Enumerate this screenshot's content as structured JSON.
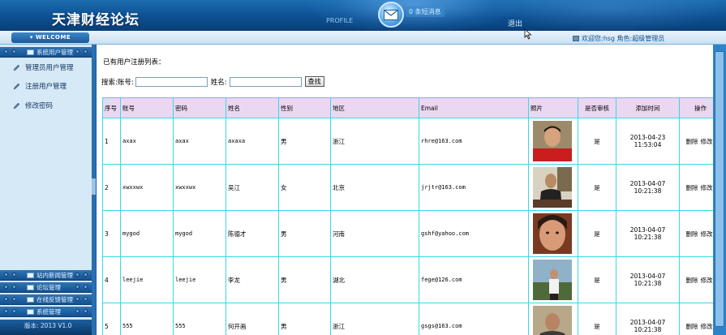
{
  "header": {
    "title": "天津财经论坛",
    "mid_text": "PROFILE",
    "right_text": "0 条短消息",
    "logout": "退出"
  },
  "welcome": {
    "badge": "WELCOME",
    "user_info": "欢迎您:hsg 角色:超级管理员"
  },
  "sidebar": {
    "top_section": "系统用户管理",
    "items": [
      {
        "label": "管理员用户管理",
        "icon": "pencil-icon"
      },
      {
        "label": "注册用户管理",
        "icon": "pencil-icon"
      },
      {
        "label": "修改密码",
        "icon": "pencil-icon"
      }
    ],
    "bottom_sections": [
      "站内新闻管理",
      "论坛管理",
      "在线反馈管理",
      "系统管理"
    ],
    "version": "版本: 2013 V1.0"
  },
  "main": {
    "page_title": "已有用户注册列表：",
    "search": {
      "prefix": "搜索:",
      "account_label": "账号:",
      "account_value": "",
      "name_label": "姓名:",
      "name_value": "",
      "button": "查找"
    },
    "table": {
      "headers": [
        "序号",
        "账号",
        "密码",
        "姓名",
        "性别",
        "地区",
        "Email",
        "照片",
        "是否审核",
        "添加时间",
        "操作"
      ],
      "rows": [
        {
          "no": "1",
          "account": "axax",
          "password": "axax",
          "name": "axaxa",
          "gender": "男",
          "region": "浙江",
          "email": "rhre@163.com",
          "approved": "是",
          "date": "2013-04-23",
          "time": "11:53:04",
          "photo": "portrait-red-shirt"
        },
        {
          "no": "2",
          "account": "xwxxwx",
          "password": "xwxxwx",
          "name": "吴江",
          "gender": "女",
          "region": "北京",
          "email": "jrjtr@163.com",
          "approved": "是",
          "date": "2013-04-07",
          "time": "10:21:38",
          "photo": "portrait-office"
        },
        {
          "no": "3",
          "account": "mygod",
          "password": "mygod",
          "name": "陈德才",
          "gender": "男",
          "region": "河南",
          "email": "gshf@yahoo.com",
          "approved": "是",
          "date": "2013-04-07",
          "time": "10:21:38",
          "photo": "portrait-closeup"
        },
        {
          "no": "4",
          "account": "leejie",
          "password": "leejie",
          "name": "李龙",
          "gender": "男",
          "region": "湖北",
          "email": "fege@126.com",
          "approved": "是",
          "date": "2013-04-07",
          "time": "10:21:38",
          "photo": "portrait-outdoor"
        },
        {
          "no": "5",
          "account": "555",
          "password": "555",
          "name": "何开画",
          "gender": "男",
          "region": "浙江",
          "email": "gsgs@163.com",
          "approved": "是",
          "date": "2013-04-07",
          "time": "10:21:38",
          "photo": "portrait-group"
        }
      ],
      "action_delete": "删除",
      "action_edit": "修改"
    }
  },
  "colors": {
    "header_blue": "#0c4f90",
    "sidebar_bg": "#d6e9f7",
    "table_border": "#38d8e6",
    "table_header_bg": "#ead7f2"
  }
}
